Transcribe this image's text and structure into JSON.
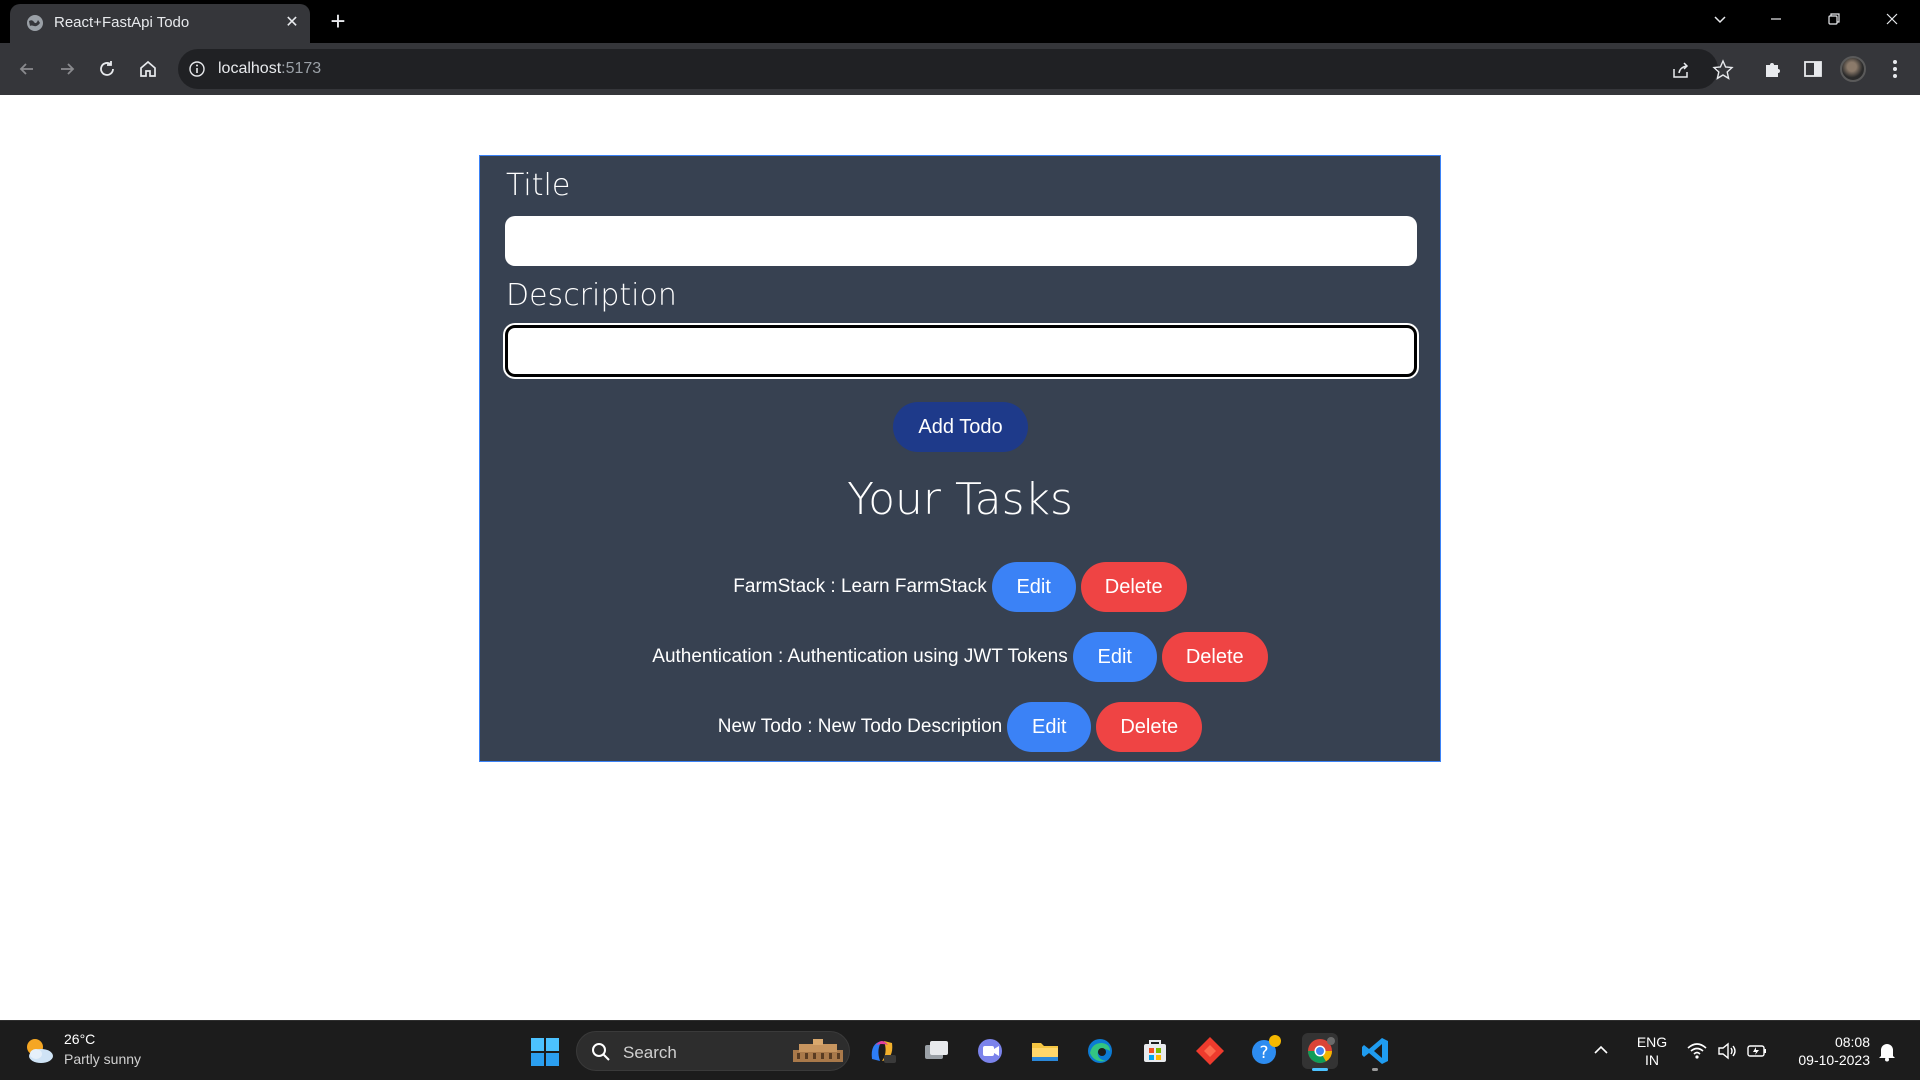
{
  "browser": {
    "tab_title": "React+FastApi Todo",
    "tab_close": "✕",
    "new_tab": "+",
    "url_host": "localhost",
    "url_port": ":5173"
  },
  "form": {
    "title_label": "Title",
    "title_value": "",
    "description_label": "Description",
    "description_value": "",
    "add_button": "Add Todo"
  },
  "tasks": {
    "heading": "Your Tasks",
    "items": [
      {
        "text": "FarmStack : Learn FarmStack",
        "edit": "Edit",
        "delete": "Delete"
      },
      {
        "text": "Authentication : Authentication using JWT Tokens",
        "edit": "Edit",
        "delete": "Delete"
      },
      {
        "text": "New Todo : New Todo Description",
        "edit": "Edit",
        "delete": "Delete"
      }
    ]
  },
  "taskbar": {
    "weather_temp": "26°C",
    "weather_desc": "Partly sunny",
    "search_label": "Search",
    "lang_line1": "ENG",
    "lang_line2": "IN",
    "time": "08:08",
    "date": "09-10-2023"
  },
  "colors": {
    "card_bg": "#374151",
    "add_button": "#1e3a8a",
    "edit_button": "#3b82f6",
    "delete_button": "#ef4444"
  }
}
